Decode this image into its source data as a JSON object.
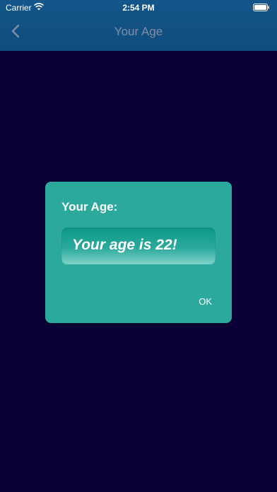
{
  "status_bar": {
    "carrier": "Carrier",
    "time": "2:54 PM"
  },
  "nav": {
    "title": "Your Age",
    "back_icon": "chevron-left-icon"
  },
  "dialog": {
    "title": "Your Age:",
    "message": "Your age is 22!",
    "ok_label": "OK"
  },
  "colors": {
    "background": "#0b0138",
    "header": "#14568a",
    "dialog": "#2aa99c",
    "text": "#ffffff"
  }
}
